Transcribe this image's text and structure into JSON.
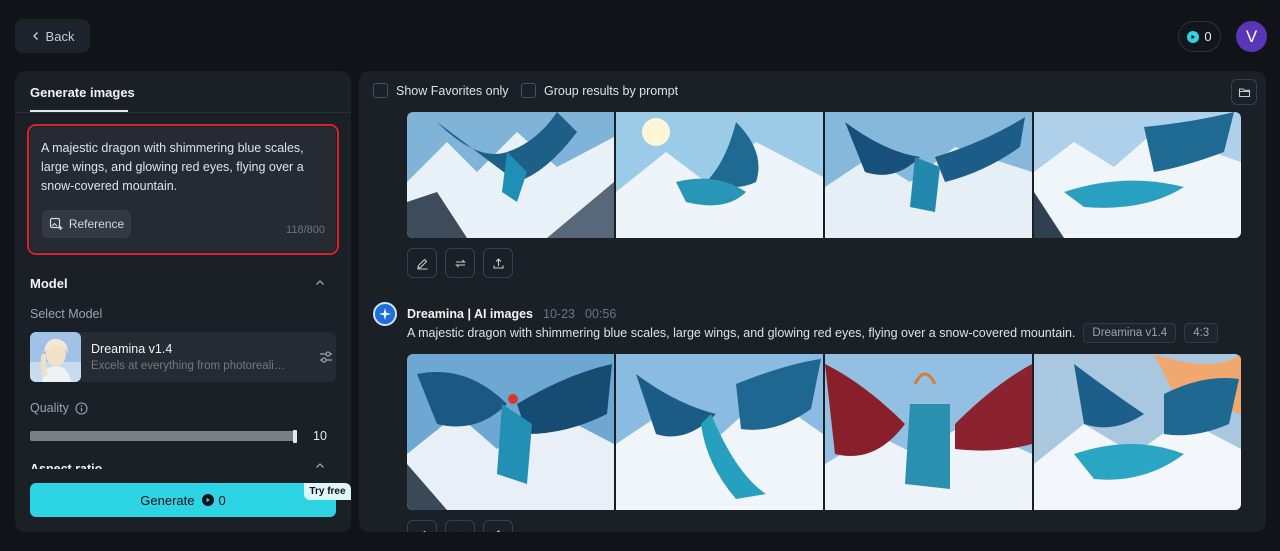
{
  "header": {
    "back_label": "Back",
    "credits": "0",
    "avatar_initial": "V"
  },
  "left_panel": {
    "tab_label": "Generate images",
    "prompt": "A majestic dragon with shimmering blue scales, large wings, and glowing red eyes, flying over a snow-covered mountain.",
    "reference_label": "Reference",
    "char_count": "118/800",
    "model_heading": "Model",
    "select_model_label": "Select Model",
    "model_name": "Dreamina v1.4",
    "model_desc": "Excels at everything from photorealism to painterly styles",
    "quality_label": "Quality",
    "quality_value": "10",
    "quality_level": 1.0,
    "aspect_heading": "Aspect ratio",
    "generate_label": "Generate",
    "generate_credits": "0",
    "try_free_label": "Try free"
  },
  "right_panel": {
    "show_favorites_label": "Show Favorites only",
    "group_results_label": "Group results by prompt",
    "generation": {
      "source": "Dreamina | AI images",
      "date": "10-23",
      "time": "00:56",
      "prompt": "A majestic dragon with shimmering blue scales, large wings, and glowing red eyes, flying over a snow-covered mountain.",
      "model_tag": "Dreamina v1.4",
      "ratio_tag": "4:3"
    }
  },
  "icons": {
    "back": "chevron-left-icon",
    "credit": "play-circle-icon",
    "reference": "image-plus-icon",
    "model_settings": "sliders-icon",
    "quality_info": "info-icon",
    "folder": "folder-icon",
    "edit": "pencil-icon",
    "regenerate": "repeat-icon",
    "export": "upload-icon"
  },
  "colors": {
    "accent": "#2dd4e3",
    "highlight_border": "#d92128",
    "avatar": "#5b35b8"
  }
}
